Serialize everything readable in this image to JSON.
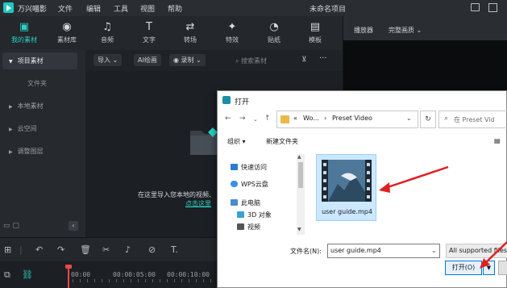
{
  "titlebar": {
    "app_name": "万兴喵影",
    "menus": [
      "文件",
      "编辑",
      "工具",
      "视图",
      "帮助"
    ],
    "doc_title": "未命名项目"
  },
  "toolbar": {
    "tools": [
      {
        "label": "我的素材",
        "icon": "media-icon",
        "glyph": "▣"
      },
      {
        "label": "素材库",
        "icon": "library-icon",
        "glyph": "◉"
      },
      {
        "label": "音频",
        "icon": "music-icon",
        "glyph": "♫"
      },
      {
        "label": "文字",
        "icon": "text-icon",
        "glyph": "T"
      },
      {
        "label": "转场",
        "icon": "transition-icon",
        "glyph": "⇄"
      },
      {
        "label": "特效",
        "icon": "effects-icon",
        "glyph": "✦"
      },
      {
        "label": "贴纸",
        "icon": "sticker-icon",
        "glyph": "◔"
      },
      {
        "label": "模板",
        "icon": "template-icon",
        "glyph": "▤"
      }
    ],
    "active_color": "#29d3c4"
  },
  "leftpanel": {
    "items": [
      "项目素材",
      "本地素材",
      "云空间",
      "调整图层"
    ],
    "sub_item": "文件夹"
  },
  "mediabar": {
    "import_label": "导入",
    "ai_label": "AI绘画",
    "record_label": "录制",
    "search_placeholder": "搜索素材"
  },
  "empty_state": {
    "text": "在这里导入您本地的视频、",
    "link": "点击这里"
  },
  "player": {
    "label": "播放器",
    "quality": "完整画质"
  },
  "timeline": {
    "times": [
      "00:00",
      "00:00:05:00",
      "00:00:10:00"
    ]
  },
  "dialog": {
    "title": "打开",
    "breadcrumb": [
      "«",
      "Wo...",
      "›",
      "Preset Video"
    ],
    "search_placeholder": "在 Preset Vid",
    "organize": "组织",
    "new_folder": "新建文件夹",
    "nav": [
      {
        "label": "快速访问",
        "icon": "star-icon",
        "color": "#2b7cd3"
      },
      {
        "label": "WPS云盘",
        "icon": "cloud-icon",
        "color": "#3d8ee8"
      },
      {
        "label": "此电脑",
        "icon": "computer-icon",
        "color": "#4a8ad0"
      },
      {
        "label": "3D 对象",
        "icon": "3d-objects-icon",
        "color": "#3aa0d8"
      },
      {
        "label": "视频",
        "icon": "video-folder-icon",
        "color": "#555555"
      }
    ],
    "file": {
      "name": "user guide.mp4"
    },
    "filename_label": "文件名(N):",
    "filename_value": "user guide.mp4",
    "filter_value": "All supported files",
    "open_label": "打开(O)"
  },
  "colors": {
    "annotation_arrow": "#e02020",
    "selection": "#cce8ff"
  }
}
